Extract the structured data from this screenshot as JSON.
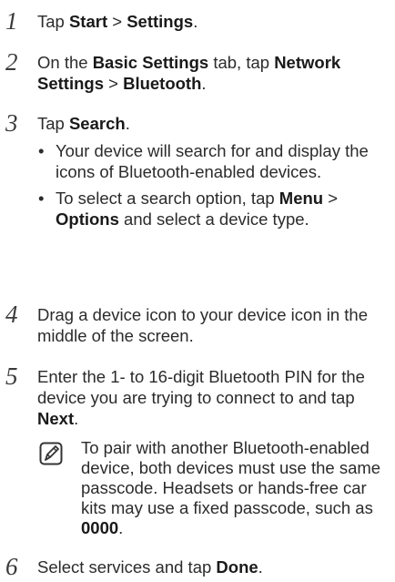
{
  "steps": [
    {
      "num": "1",
      "parts": [
        {
          "t": "Tap "
        },
        {
          "b": "Start"
        },
        {
          "t": " > "
        },
        {
          "b": "Settings"
        },
        {
          "t": "."
        }
      ]
    },
    {
      "num": "2",
      "parts": [
        {
          "t": "On the "
        },
        {
          "b": "Basic Settings"
        },
        {
          "t": " tab, tap "
        },
        {
          "b": "Network Settings"
        },
        {
          "t": " > "
        },
        {
          "b": "Bluetooth"
        },
        {
          "t": "."
        }
      ]
    },
    {
      "num": "3",
      "parts": [
        {
          "t": "Tap "
        },
        {
          "b": "Search"
        },
        {
          "t": "."
        }
      ]
    },
    {
      "num": "4",
      "parts": [
        {
          "t": "Drag a device icon to your device icon in the middle of the screen."
        }
      ]
    },
    {
      "num": "5",
      "parts": [
        {
          "t": "Enter the 1- to 16-digit Bluetooth PIN for the device you are trying to connect to and tap "
        },
        {
          "b": "Next"
        },
        {
          "t": "."
        }
      ]
    },
    {
      "num": "6",
      "parts": [
        {
          "t": "Select services and tap "
        },
        {
          "b": "Done"
        },
        {
          "t": "."
        }
      ]
    }
  ],
  "step3_bullets": [
    {
      "parts": [
        {
          "t": "Your device will search for and display the icons of Bluetooth-enabled devices."
        }
      ]
    },
    {
      "parts": [
        {
          "t": "To select a search option, tap "
        },
        {
          "b": "Menu"
        },
        {
          "t": " > "
        },
        {
          "b": "Options"
        },
        {
          "t": " and select a device type."
        }
      ]
    }
  ],
  "note": {
    "icon": "note-pencil-icon",
    "parts": [
      {
        "t": "To pair with another Bluetooth-enabled device, both devices must use the same passcode. Headsets or hands-free car kits may use a fixed passcode, such as "
      },
      {
        "b": "0000"
      },
      {
        "t": "."
      }
    ]
  }
}
